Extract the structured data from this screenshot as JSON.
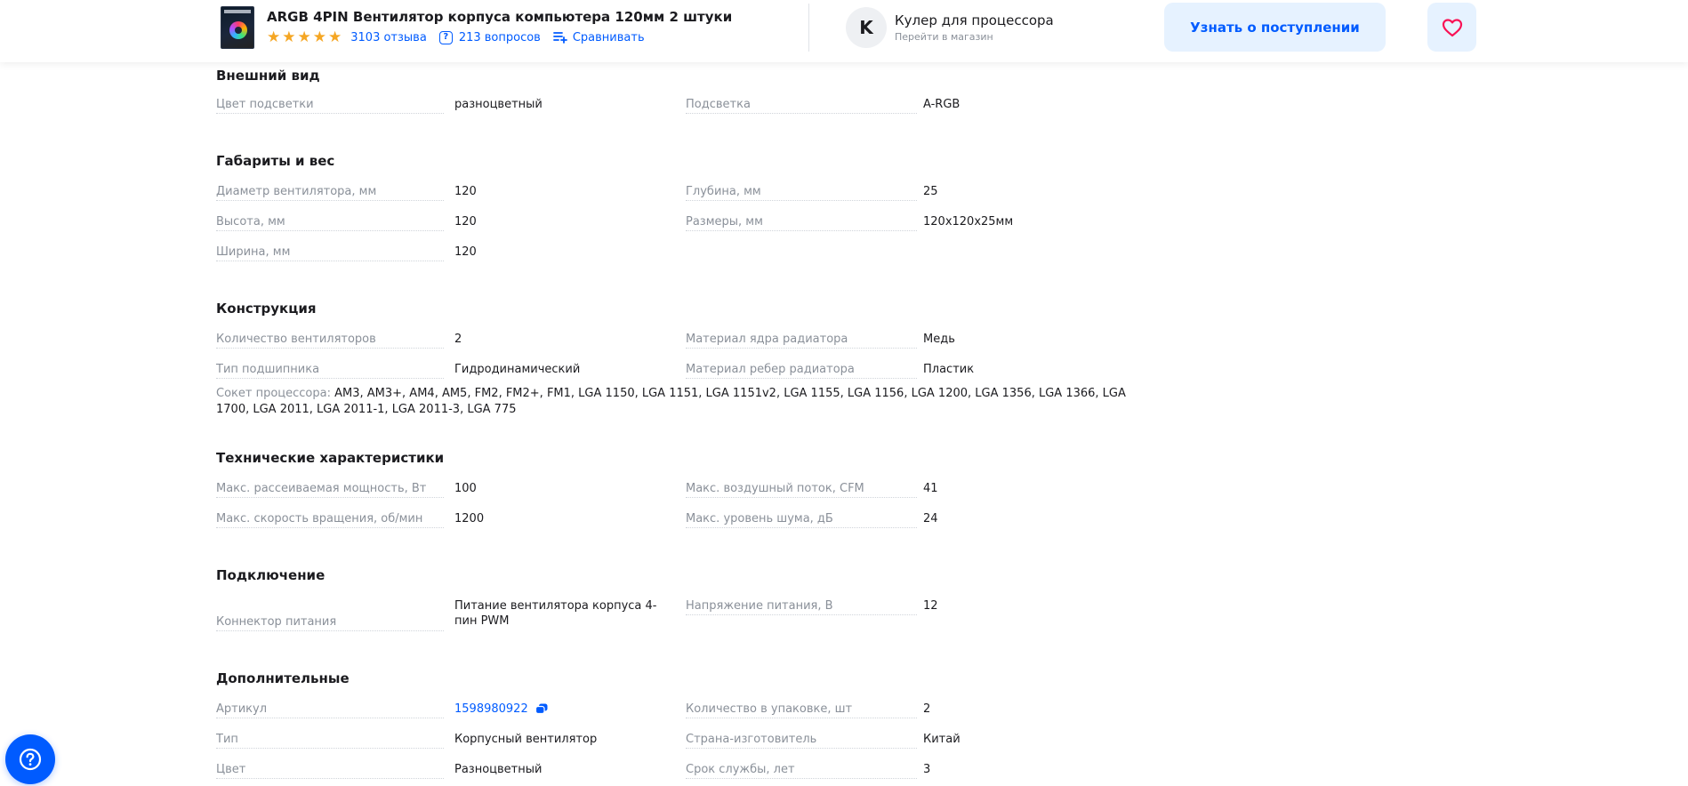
{
  "header": {
    "product_title": "ARGB 4PIN Вентилятор корпуса компьютера 120мм 2 штуки",
    "rating_stars": 5,
    "reviews": "3103 отзыва",
    "questions": "213 вопросов",
    "compare": "Сравнивать",
    "shop_initial": "K",
    "shop_name": "Кулер для процессора",
    "shop_link": "Перейти в магазин",
    "notify_button": "Узнать о поступлении"
  },
  "sections": {
    "appearance": {
      "title": "Внешний вид",
      "backlight_color_label": "Цвет подсветки",
      "backlight_color_value": "разноцветный",
      "backlight_label": "Подсветка",
      "backlight_value": "A-RGB"
    },
    "dimensions": {
      "title": "Габариты и вес",
      "fan_diameter_label": "Диаметр вентилятора, мм",
      "fan_diameter_value": "120",
      "depth_label": "Глубина, мм",
      "depth_value": "25",
      "height_label": "Высота, мм",
      "height_value": "120",
      "size_label": "Размеры, мм",
      "size_value": "120х120х25мм",
      "width_label": "Ширина, мм",
      "width_value": "120"
    },
    "construction": {
      "title": "Конструкция",
      "fan_count_label": "Количество вентиляторов",
      "fan_count_value": "2",
      "core_material_label": "Материал ядра радиатора",
      "core_material_value": "Медь",
      "bearing_label": "Тип подшипника",
      "bearing_value": "Гидродинамический",
      "fin_material_label": "Материал ребер радиатора",
      "fin_material_value": "Пластик",
      "socket_label": "Сокет процессора:",
      "socket_value": "AM3, AM3+, AM4, AM5, FM2, FM2+, FM1, LGA 1150, LGA 1151, LGA 1151v2, LGA 1155, LGA 1156, LGA 1200, LGA 1356, LGA 1366, LGA 1700, LGA 2011, LGA 2011-1, LGA 2011-3, LGA 775"
    },
    "technical": {
      "title": "Технические характеристики",
      "max_power_label": "Макс. рассеиваемая мощность, Вт",
      "max_power_value": "100",
      "max_airflow_label": "Макс. воздушный поток, CFM",
      "max_airflow_value": "41",
      "max_speed_label": "Макс. скорость вращения, об/мин",
      "max_speed_value": "1200",
      "max_noise_label": "Макс. уровень шума, дБ",
      "max_noise_value": "24"
    },
    "connection": {
      "title": "Подключение",
      "power_connector_label": "Коннектор питания",
      "power_connector_value": "Питание вентилятора корпуса 4-пин PWM",
      "voltage_label": "Напряжение питания, В",
      "voltage_value": "12"
    },
    "additional": {
      "title": "Дополнительные",
      "sku_label": "Артикул",
      "sku_value": "1598980922",
      "pack_qty_label": "Количество в упаковке, шт",
      "pack_qty_value": "2",
      "type_label": "Тип",
      "type_value": "Корпусный вентилятор",
      "country_label": "Страна-изготовитель",
      "country_value": "Китай",
      "color_label": "Цвет",
      "color_value": "Разноцветный",
      "lifetime_label": "Срок службы, лет",
      "lifetime_value": "3"
    }
  },
  "colors": {
    "accent": "#005bff",
    "accent_light": "#e6f2ff",
    "star": "#f5a623",
    "heart": "#f91155",
    "muted_text": "#8a9099"
  },
  "icons": {
    "star": "star-icon",
    "question": "question-icon",
    "compare": "compare-icon",
    "heart": "heart-icon",
    "copy": "copy-icon",
    "help": "help-icon"
  }
}
